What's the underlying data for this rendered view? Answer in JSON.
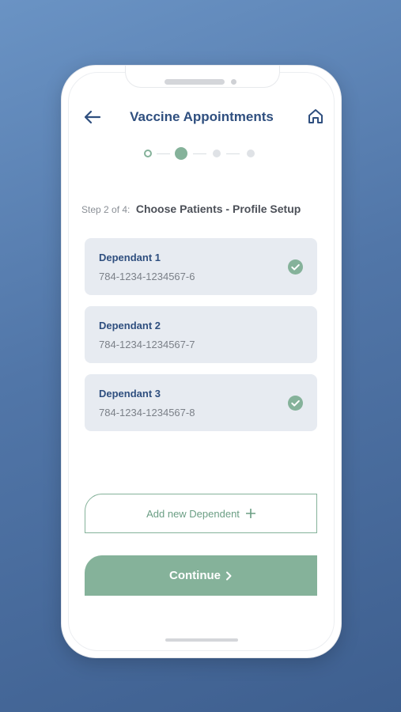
{
  "header": {
    "title": "Vaccine Appointments",
    "back_icon": "arrow-left-icon",
    "home_icon": "home-icon"
  },
  "stepper": {
    "total_steps": 4,
    "current_step": 2
  },
  "step_label": {
    "prefix": "Step 2 of 4:",
    "title": "Choose Patients - Profile Setup"
  },
  "dependants": [
    {
      "name": "Dependant 1",
      "id": "784-1234-1234567-6",
      "selected": true
    },
    {
      "name": "Dependant 2",
      "id": "784-1234-1234567-7",
      "selected": false
    },
    {
      "name": "Dependant 3",
      "id": "784-1234-1234567-8",
      "selected": true
    }
  ],
  "add_button": {
    "label": "Add new Dependent",
    "icon": "plus-icon"
  },
  "continue_button": {
    "label": "Continue",
    "icon": "chevron-right-icon"
  },
  "colors": {
    "accent": "#85b29a",
    "primary_text": "#2f4f7f",
    "card_bg": "#e7ebf1"
  }
}
